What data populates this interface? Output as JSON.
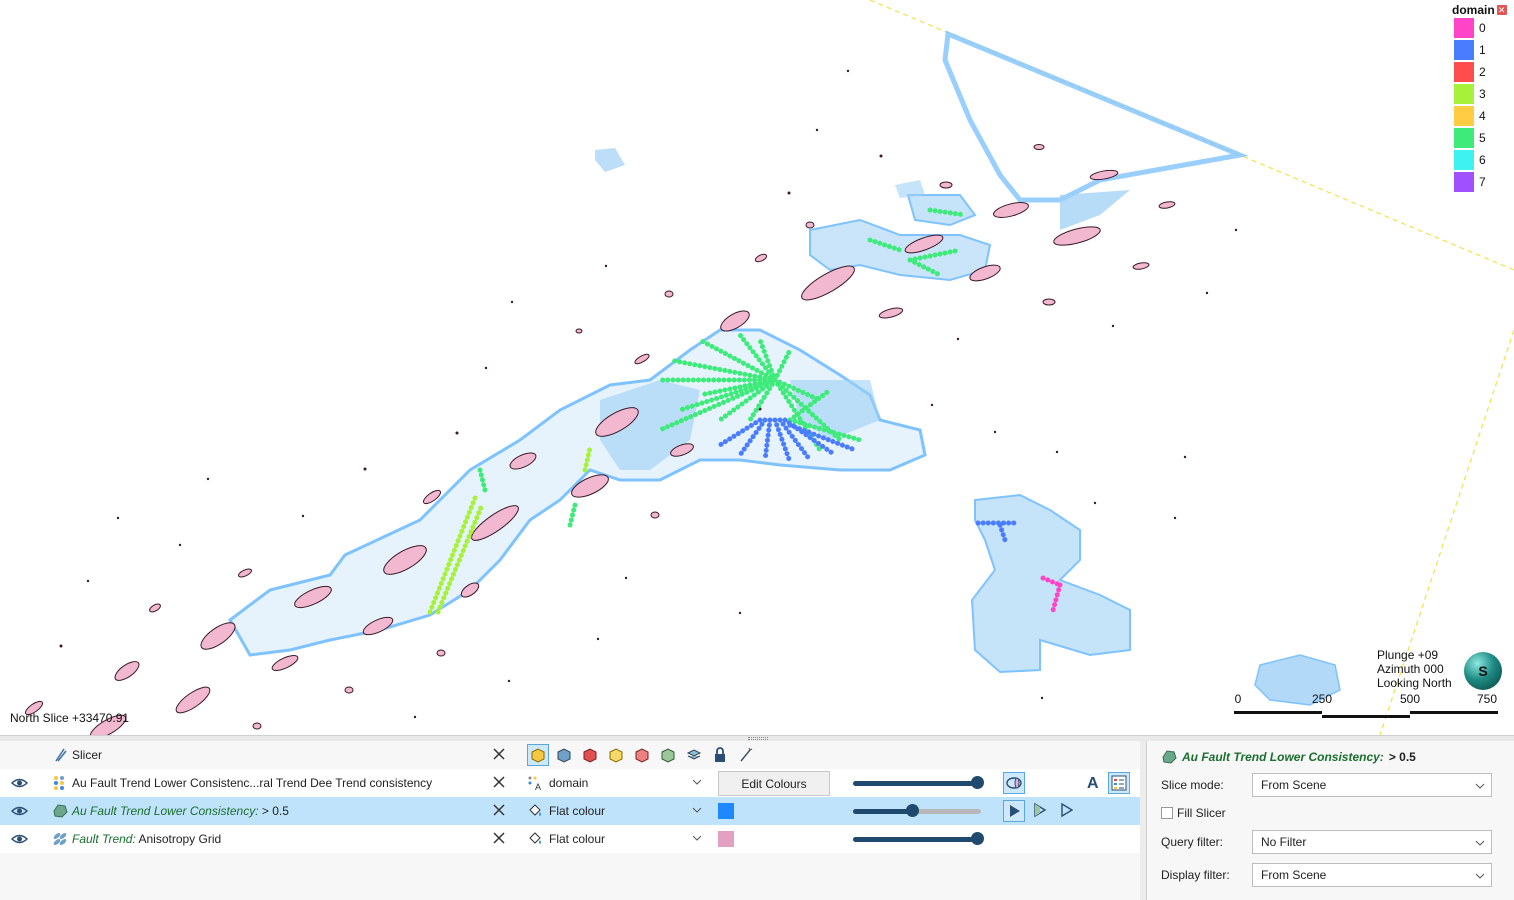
{
  "legend": {
    "title": "domain",
    "items": [
      {
        "label": "0",
        "color": "#ff44c8"
      },
      {
        "label": "1",
        "color": "#4a7cff"
      },
      {
        "label": "2",
        "color": "#ff4d4d"
      },
      {
        "label": "3",
        "color": "#a6f23a"
      },
      {
        "label": "4",
        "color": "#ffcc44"
      },
      {
        "label": "5",
        "color": "#3dea7a"
      },
      {
        "label": "6",
        "color": "#3ef2f2"
      },
      {
        "label": "7",
        "color": "#a050ff"
      }
    ]
  },
  "scene": {
    "north_slice": "North Slice +33470.91",
    "plunge": "Plunge +09",
    "azimuth": "Azimuth 000",
    "looking": "Looking North",
    "compass_letter": "S",
    "scale_labels": [
      "0",
      "250",
      "500",
      "750"
    ]
  },
  "layers": {
    "slicer": {
      "label": "Slicer"
    },
    "rows": [
      {
        "name_plain": "Au Fault Trend Lower Consistenc...ral Trend Dee Trend consistency",
        "style": "domain",
        "button": "Edit Colours"
      },
      {
        "name_italic": "Au Fault Trend Lower Consistency:",
        "name_rest": " > 0.5",
        "style": "Flat colour",
        "swatch": "#1e88ff",
        "opacity": 0.45
      },
      {
        "name_italic": "Fault Trend:",
        "name_rest": " Anisotropy Grid",
        "style": "Flat colour",
        "swatch": "#e4a0c0",
        "opacity": 1.0
      }
    ]
  },
  "props": {
    "title_italic": "Au Fault Trend Lower Consistency:",
    "title_rest": " > 0.5",
    "slice_mode_label": "Slice mode:",
    "slice_mode_value": "From Scene",
    "fill_slicer_label": "Fill Slicer",
    "query_filter_label": "Query filter:",
    "query_filter_value": "No Filter",
    "display_filter_label": "Display filter:",
    "display_filter_value": "From Scene"
  }
}
